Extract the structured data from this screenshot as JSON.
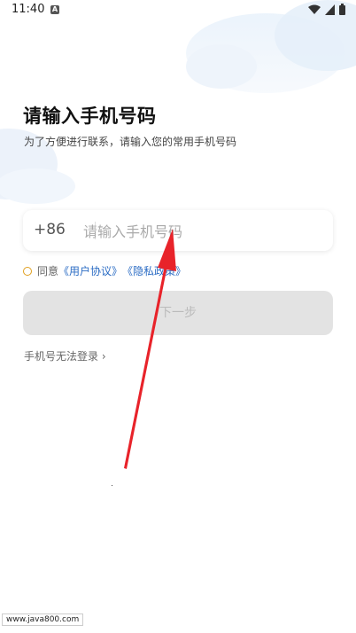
{
  "status_bar": {
    "time": "11:40",
    "app_icon_letter": "A",
    "icons": [
      "wifi-icon",
      "signal-icon",
      "battery-icon"
    ]
  },
  "header": {
    "title": "请输入手机号码",
    "subtitle": "为了方便进行联系，请输入您的常用手机号码"
  },
  "phone_field": {
    "country_code": "+86",
    "placeholder": "请输入手机号码",
    "value": ""
  },
  "agreement": {
    "prefix": "同意",
    "user_agreement": "《用户协议》",
    "privacy_policy": "《隐私政策》",
    "checked": false
  },
  "next_button": {
    "label": "下一步",
    "enabled": false
  },
  "cannot_login": {
    "label": "手机号无法登录",
    "chevron": "›"
  },
  "watermark": {
    "text": "www.java800.com"
  },
  "colors": {
    "accent_link": "#2b6cc4",
    "radio_border": "#e0a020",
    "disabled_button": "#e3e3e3",
    "annotation_arrow": "#e8232a"
  }
}
